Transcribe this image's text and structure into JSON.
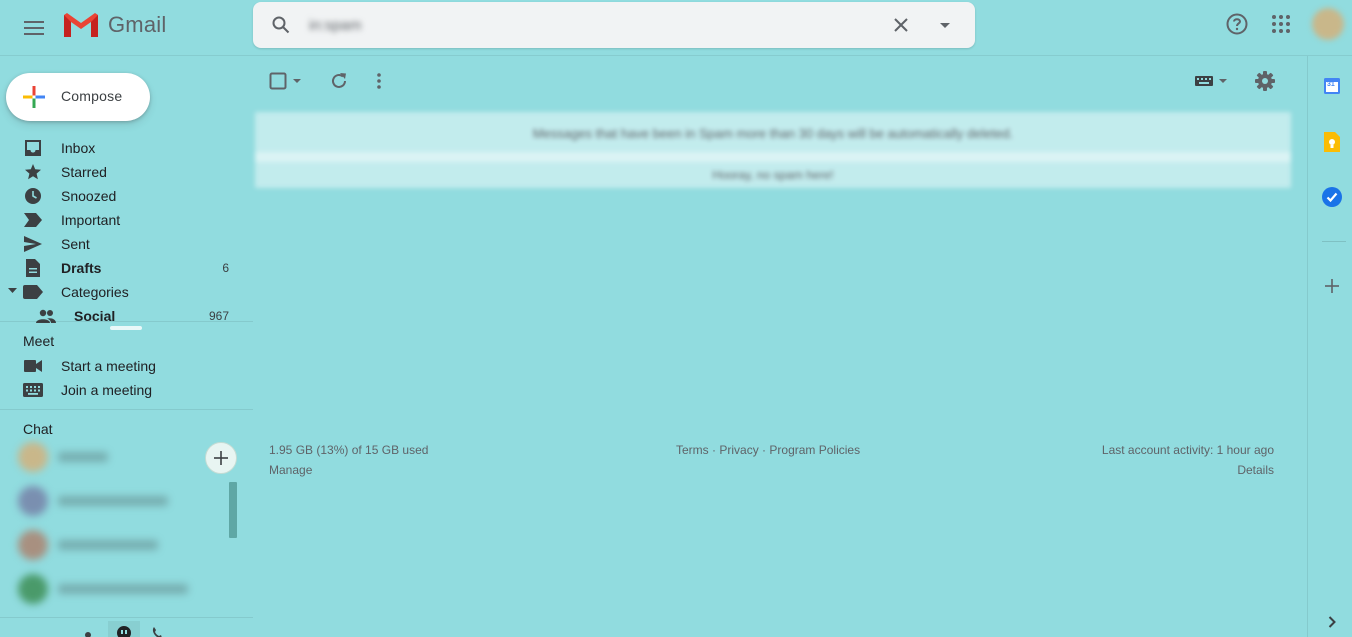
{
  "app": {
    "name": "Gmail"
  },
  "search": {
    "query": "in:spam"
  },
  "compose": {
    "label": "Compose"
  },
  "nav": {
    "items": [
      {
        "label": "Inbox",
        "icon": "inbox-icon",
        "bold": false,
        "count": ""
      },
      {
        "label": "Starred",
        "icon": "star-icon",
        "bold": false,
        "count": ""
      },
      {
        "label": "Snoozed",
        "icon": "clock-icon",
        "bold": false,
        "count": ""
      },
      {
        "label": "Important",
        "icon": "important-icon",
        "bold": false,
        "count": ""
      },
      {
        "label": "Sent",
        "icon": "send-icon",
        "bold": false,
        "count": ""
      },
      {
        "label": "Drafts",
        "icon": "draft-icon",
        "bold": true,
        "count": "6"
      },
      {
        "label": "Categories",
        "icon": "label-icon",
        "bold": false,
        "count": ""
      },
      {
        "label": "Social",
        "icon": "people-icon",
        "bold": true,
        "count": "967"
      }
    ]
  },
  "meet": {
    "title": "Meet",
    "start_label": "Start a meeting",
    "join_label": "Join a meeting"
  },
  "chat": {
    "title": "Chat"
  },
  "message": {
    "line1": "Messages that have been in Spam more than 30 days will be automatically deleted.",
    "line2": "Hooray, no spam here!"
  },
  "footer": {
    "storage": "1.95 GB (13%) of 15 GB used",
    "manage": "Manage",
    "terms": "Terms",
    "privacy": "Privacy",
    "policies": "Program Policies",
    "separator": "·",
    "activity": "Last account activity: 1 hour ago",
    "details": "Details"
  },
  "right_panel": {
    "calendar_day": "31"
  },
  "colors": {
    "background": "#91dcdf",
    "gmail_red": "#ea4335",
    "google_blue": "#4285f4",
    "google_yellow": "#fbbc04",
    "google_green": "#34a853",
    "icon_gray": "#5f6368"
  }
}
